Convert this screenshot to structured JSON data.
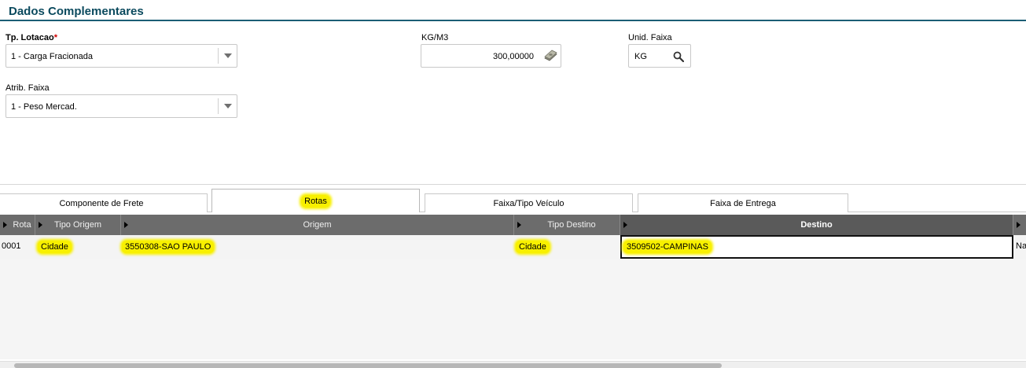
{
  "section": {
    "title": "Dados Complementares"
  },
  "form": {
    "tp_lotacao": {
      "label": "Tp. Lotacao",
      "required_mark": "*",
      "value": "1 - Carga Fracionada"
    },
    "kg_m3": {
      "label": "KG/M3",
      "value": "300,00000"
    },
    "unid_faixa": {
      "label": "Unid. Faixa",
      "value": "KG"
    },
    "atrib_faixa": {
      "label": "Atrib. Faixa",
      "value": "1 - Peso Mercad."
    }
  },
  "tabs": [
    {
      "label": "Componente de Frete"
    },
    {
      "label": "Rotas"
    },
    {
      "label": "Faixa/Tipo Veículo"
    },
    {
      "label": "Faixa de Entrega"
    }
  ],
  "grid": {
    "columns": [
      "Rota",
      "Tipo Origem",
      "Origem",
      "Tipo Destino",
      "Destino"
    ],
    "rows": [
      {
        "rota": "0001",
        "tipo_origem": "Cidade",
        "origem": "3550308-SAO PAULO",
        "tipo_destino": "Cidade",
        "destino": "3509502-CAMPINAS",
        "extra": "Na"
      }
    ]
  },
  "colors": {
    "title": "#0b4a5e",
    "header_bg": "#6c6c6c",
    "highlight": "#f8f000"
  }
}
